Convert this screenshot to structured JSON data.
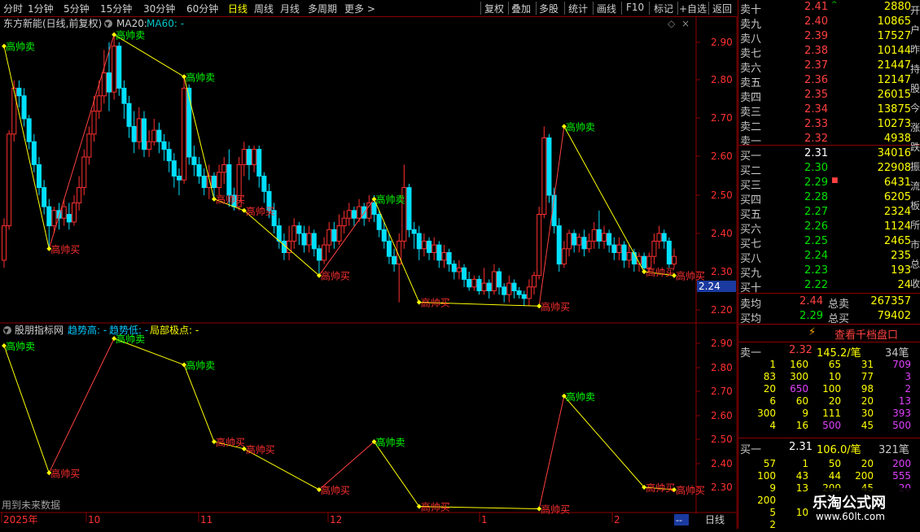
{
  "toolbar": {
    "periods": [
      "分时",
      "1分钟",
      "5分钟",
      "15分钟",
      "30分钟",
      "60分钟",
      "日线",
      "周线",
      "月线",
      "多周期",
      "更多 >"
    ],
    "active": "日线",
    "tools": [
      "复权",
      "叠加",
      "多股",
      "统计",
      "画线",
      "F10",
      "标记",
      "+自选",
      "返回"
    ]
  },
  "main_chart": {
    "title": "东方新能(日线,前复权)",
    "ma20_label": "MA20:",
    "ma60_label": "MA60: -",
    "price_ticks": [
      "2.90",
      "2.80",
      "2.70",
      "2.60",
      "2.50",
      "2.40",
      "2.30",
      "2.20"
    ],
    "current_price_tag": "2.24",
    "label_sell": "高帅卖",
    "label_buy": "高帅买"
  },
  "indicator": {
    "title": "股朋指标网",
    "trend_high": "趋势高: -",
    "trend_low": "趋势低: -",
    "local_extreme": "局部极点: -",
    "ticks": [
      "2.90",
      "2.80",
      "2.70",
      "2.60",
      "2.50",
      "2.40",
      "2.30"
    ],
    "note": "用到未来数据"
  },
  "time_axis": {
    "labels": [
      "2025年",
      "10",
      "11",
      "12",
      "1",
      "2"
    ],
    "end_marker": "--",
    "period_label": "日线"
  },
  "chart_data": {
    "type": "line",
    "title": "",
    "ylim": [
      2.17,
      2.93
    ],
    "pivots": [
      {
        "x": 0,
        "price": 2.89,
        "kind": "sell"
      },
      {
        "x": 9,
        "price": 2.36,
        "kind": "buy"
      },
      {
        "x": 22,
        "price": 2.92,
        "kind": "sell"
      },
      {
        "x": 36,
        "price": 2.81,
        "kind": "sell"
      },
      {
        "x": 42,
        "price": 2.49,
        "kind": "buy"
      },
      {
        "x": 48,
        "price": 2.46,
        "kind": "buy"
      },
      {
        "x": 63,
        "price": 2.29,
        "kind": "buy"
      },
      {
        "x": 74,
        "price": 2.49,
        "kind": "sell"
      },
      {
        "x": 83,
        "price": 2.22,
        "kind": "buy"
      },
      {
        "x": 107,
        "price": 2.21,
        "kind": "buy"
      },
      {
        "x": 112,
        "price": 2.68,
        "kind": "sell"
      },
      {
        "x": 128,
        "price": 2.3,
        "kind": "buy"
      },
      {
        "x": 134,
        "price": 2.29,
        "kind": "buy"
      }
    ],
    "candles": [
      [
        2.33,
        2.42,
        2.31,
        2.44
      ],
      [
        2.42,
        2.66,
        2.41,
        2.67
      ],
      [
        2.66,
        2.78,
        2.64,
        2.8
      ],
      [
        2.78,
        2.76,
        2.73,
        2.8
      ],
      [
        2.76,
        2.7,
        2.68,
        2.78
      ],
      [
        2.7,
        2.64,
        2.62,
        2.71
      ],
      [
        2.64,
        2.58,
        2.56,
        2.66
      ],
      [
        2.58,
        2.52,
        2.5,
        2.6
      ],
      [
        2.52,
        2.47,
        2.45,
        2.54
      ],
      [
        2.47,
        2.42,
        2.36,
        2.49
      ],
      [
        2.42,
        2.46,
        2.4,
        2.47
      ],
      [
        2.46,
        2.44,
        2.41,
        2.48
      ],
      [
        2.44,
        2.47,
        2.42,
        2.49
      ],
      [
        2.45,
        2.43,
        2.41,
        2.48
      ],
      [
        2.43,
        2.48,
        2.42,
        2.5
      ],
      [
        2.48,
        2.52,
        2.46,
        2.55
      ],
      [
        2.52,
        2.6,
        2.5,
        2.62
      ],
      [
        2.6,
        2.66,
        2.58,
        2.68
      ],
      [
        2.66,
        2.72,
        2.64,
        2.76
      ],
      [
        2.72,
        2.76,
        2.7,
        2.8
      ],
      [
        2.76,
        2.82,
        2.74,
        2.88
      ],
      [
        2.82,
        2.77,
        2.72,
        2.9
      ],
      [
        2.77,
        2.89,
        2.75,
        2.92
      ],
      [
        2.89,
        2.78,
        2.76,
        2.9
      ],
      [
        2.78,
        2.74,
        2.7,
        2.8
      ],
      [
        2.74,
        2.68,
        2.65,
        2.76
      ],
      [
        2.68,
        2.64,
        2.61,
        2.72
      ],
      [
        2.64,
        2.7,
        2.62,
        2.73
      ],
      [
        2.7,
        2.62,
        2.6,
        2.72
      ],
      [
        2.62,
        2.64,
        2.6,
        2.67
      ],
      [
        2.64,
        2.67,
        2.63,
        2.7
      ],
      [
        2.67,
        2.64,
        2.61,
        2.69
      ],
      [
        2.64,
        2.62,
        2.59,
        2.66
      ],
      [
        2.62,
        2.59,
        2.56,
        2.64
      ],
      [
        2.59,
        2.55,
        2.52,
        2.61
      ],
      [
        2.55,
        2.54,
        2.5,
        2.57
      ],
      [
        2.54,
        2.78,
        2.53,
        2.81
      ],
      [
        2.78,
        2.6,
        2.58,
        2.79
      ],
      [
        2.6,
        2.58,
        2.55,
        2.63
      ],
      [
        2.58,
        2.55,
        2.53,
        2.6
      ],
      [
        2.55,
        2.52,
        2.5,
        2.57
      ],
      [
        2.52,
        2.55,
        2.49,
        2.58
      ],
      [
        2.55,
        2.52,
        2.49,
        2.56
      ],
      [
        2.52,
        2.56,
        2.5,
        2.58
      ],
      [
        2.56,
        2.58,
        2.53,
        2.6
      ],
      [
        2.58,
        2.5,
        2.47,
        2.62
      ],
      [
        2.5,
        2.47,
        2.46,
        2.52
      ],
      [
        2.47,
        2.58,
        2.46,
        2.6
      ],
      [
        2.58,
        2.62,
        2.55,
        2.64
      ],
      [
        2.62,
        2.58,
        2.54,
        2.63
      ],
      [
        2.58,
        2.62,
        2.56,
        2.63
      ],
      [
        2.62,
        2.55,
        2.52,
        2.63
      ],
      [
        2.55,
        2.51,
        2.48,
        2.56
      ],
      [
        2.51,
        2.46,
        2.44,
        2.53
      ],
      [
        2.46,
        2.42,
        2.4,
        2.48
      ],
      [
        2.42,
        2.38,
        2.36,
        2.44
      ],
      [
        2.38,
        2.35,
        2.33,
        2.4
      ],
      [
        2.35,
        2.38,
        2.33,
        2.42
      ],
      [
        2.38,
        2.42,
        2.36,
        2.44
      ],
      [
        2.42,
        2.4,
        2.37,
        2.43
      ],
      [
        2.4,
        2.37,
        2.35,
        2.42
      ],
      [
        2.37,
        2.4,
        2.35,
        2.42
      ],
      [
        2.4,
        2.36,
        2.34,
        2.41
      ],
      [
        2.36,
        2.33,
        2.29,
        2.37
      ],
      [
        2.33,
        2.37,
        2.32,
        2.39
      ],
      [
        2.37,
        2.41,
        2.35,
        2.43
      ],
      [
        2.41,
        2.38,
        2.36,
        2.43
      ],
      [
        2.38,
        2.42,
        2.37,
        2.45
      ],
      [
        2.42,
        2.44,
        2.4,
        2.46
      ],
      [
        2.44,
        2.46,
        2.42,
        2.48
      ],
      [
        2.46,
        2.44,
        2.42,
        2.47
      ],
      [
        2.44,
        2.47,
        2.43,
        2.49
      ],
      [
        2.47,
        2.44,
        2.42,
        2.48
      ],
      [
        2.44,
        2.48,
        2.43,
        2.5
      ],
      [
        2.48,
        2.45,
        2.43,
        2.5
      ],
      [
        2.45,
        2.41,
        2.39,
        2.46
      ],
      [
        2.41,
        2.38,
        2.36,
        2.43
      ],
      [
        2.38,
        2.34,
        2.32,
        2.4
      ],
      [
        2.34,
        2.32,
        2.3,
        2.36
      ],
      [
        2.32,
        2.38,
        2.22,
        2.4
      ],
      [
        2.38,
        2.52,
        2.36,
        2.58
      ],
      [
        2.52,
        2.41,
        2.39,
        2.53
      ],
      [
        2.41,
        2.4,
        2.36,
        2.43
      ],
      [
        2.4,
        2.36,
        2.33,
        2.42
      ],
      [
        2.36,
        2.38,
        2.34,
        2.4
      ],
      [
        2.38,
        2.35,
        2.33,
        2.39
      ],
      [
        2.35,
        2.37,
        2.33,
        2.39
      ],
      [
        2.37,
        2.33,
        2.31,
        2.38
      ],
      [
        2.33,
        2.35,
        2.31,
        2.37
      ],
      [
        2.35,
        2.32,
        2.3,
        2.36
      ],
      [
        2.32,
        2.3,
        2.28,
        2.33
      ],
      [
        2.3,
        2.31,
        2.28,
        2.33
      ],
      [
        2.31,
        2.28,
        2.26,
        2.32
      ],
      [
        2.28,
        2.26,
        2.25,
        2.3
      ],
      [
        2.26,
        2.28,
        2.25,
        2.29
      ],
      [
        2.28,
        2.25,
        2.24,
        2.29
      ],
      [
        2.25,
        2.27,
        2.24,
        2.31
      ],
      [
        2.27,
        2.25,
        2.23,
        2.28
      ],
      [
        2.25,
        2.3,
        2.24,
        2.32
      ],
      [
        2.3,
        2.26,
        2.24,
        2.31
      ],
      [
        2.26,
        2.24,
        2.22,
        2.27
      ],
      [
        2.24,
        2.27,
        2.22,
        2.29
      ],
      [
        2.27,
        2.25,
        2.23,
        2.28
      ],
      [
        2.25,
        2.24,
        2.23,
        2.26
      ],
      [
        2.24,
        2.23,
        2.21,
        2.25
      ],
      [
        2.23,
        2.26,
        2.21,
        2.28
      ],
      [
        2.26,
        2.29,
        2.24,
        2.3
      ],
      [
        2.29,
        2.45,
        2.28,
        2.47
      ],
      [
        2.45,
        2.65,
        2.44,
        2.68
      ],
      [
        2.65,
        2.5,
        2.48,
        2.66
      ],
      [
        2.5,
        2.42,
        2.4,
        2.52
      ],
      [
        2.42,
        2.32,
        2.3,
        2.44
      ],
      [
        2.32,
        2.36,
        2.31,
        2.38
      ],
      [
        2.36,
        2.4,
        2.34,
        2.41
      ],
      [
        2.4,
        2.37,
        2.35,
        2.41
      ],
      [
        2.37,
        2.39,
        2.35,
        2.4
      ],
      [
        2.39,
        2.36,
        2.34,
        2.41
      ],
      [
        2.36,
        2.38,
        2.35,
        2.4
      ],
      [
        2.38,
        2.41,
        2.36,
        2.43
      ],
      [
        2.41,
        2.38,
        2.36,
        2.46
      ],
      [
        2.38,
        2.4,
        2.36,
        2.42
      ],
      [
        2.4,
        2.37,
        2.35,
        2.41
      ],
      [
        2.37,
        2.35,
        2.33,
        2.39
      ],
      [
        2.35,
        2.37,
        2.33,
        2.39
      ],
      [
        2.37,
        2.33,
        2.31,
        2.38
      ],
      [
        2.33,
        2.35,
        2.31,
        2.37
      ],
      [
        2.35,
        2.32,
        2.3,
        2.36
      ],
      [
        2.32,
        2.34,
        2.3,
        2.35
      ],
      [
        2.34,
        2.31,
        2.3,
        2.35
      ],
      [
        2.31,
        2.34,
        2.3,
        2.35
      ],
      [
        2.34,
        2.38,
        2.32,
        2.4
      ],
      [
        2.38,
        2.4,
        2.36,
        2.42
      ],
      [
        2.4,
        2.38,
        2.36,
        2.41
      ],
      [
        2.38,
        2.32,
        2.31,
        2.39
      ],
      [
        2.32,
        2.34,
        2.31,
        2.36
      ]
    ]
  },
  "orderbook": {
    "asks": [
      {
        "label": "卖十",
        "price": "2.41",
        "vol": "2880",
        "mark": "^"
      },
      {
        "label": "卖九",
        "price": "2.40",
        "vol": "10865",
        "mark": ""
      },
      {
        "label": "卖八",
        "price": "2.39",
        "vol": "17527",
        "mark": ""
      },
      {
        "label": "卖七",
        "price": "2.38",
        "vol": "10144",
        "mark": ""
      },
      {
        "label": "卖六",
        "price": "2.37",
        "vol": "21447",
        "mark": ""
      },
      {
        "label": "卖五",
        "price": "2.36",
        "vol": "12147",
        "mark": ""
      },
      {
        "label": "卖四",
        "price": "2.35",
        "vol": "26015",
        "mark": ""
      },
      {
        "label": "卖三",
        "price": "2.34",
        "vol": "13875",
        "mark": ""
      },
      {
        "label": "卖二",
        "price": "2.33",
        "vol": "10273",
        "mark": ""
      },
      {
        "label": "卖一",
        "price": "2.32",
        "vol": "4938",
        "mark": ""
      }
    ],
    "bids": [
      {
        "label": "买一",
        "price": "2.31",
        "vol": "34016",
        "color": "white",
        "mark": ""
      },
      {
        "label": "买二",
        "price": "2.30",
        "vol": "22908",
        "color": "green",
        "mark": ""
      },
      {
        "label": "买三",
        "price": "2.29",
        "vol": "6431",
        "color": "green",
        "mark": "■"
      },
      {
        "label": "买四",
        "price": "2.28",
        "vol": "6205",
        "color": "green",
        "mark": ""
      },
      {
        "label": "买五",
        "price": "2.27",
        "vol": "2324",
        "color": "green",
        "mark": ""
      },
      {
        "label": "买六",
        "price": "2.26",
        "vol": "1124",
        "color": "green",
        "mark": ""
      },
      {
        "label": "买七",
        "price": "2.25",
        "vol": "2465",
        "color": "green",
        "mark": ""
      },
      {
        "label": "买八",
        "price": "2.24",
        "vol": "235",
        "color": "green",
        "mark": ""
      },
      {
        "label": "买九",
        "price": "2.23",
        "vol": "193",
        "color": "green",
        "mark": ""
      },
      {
        "label": "买十",
        "price": "2.22",
        "vol": "24",
        "color": "green",
        "mark": ""
      }
    ],
    "avg_sell": {
      "label": "卖均",
      "price": "2.44",
      "tlabel": "总卖",
      "vol": "267357"
    },
    "avg_buy": {
      "label": "买均",
      "price": "2.29",
      "tlabel": "总买",
      "vol": "79402"
    },
    "tenlevel_button": "查看千档盘口",
    "ask1_queue": {
      "label": "卖一",
      "price": "2.32",
      "avg": "145.2/笔",
      "count": "34笔"
    },
    "ask_queue_rows": [
      [
        "1",
        "160",
        "65",
        "31",
        "709"
      ],
      [
        "83",
        "300",
        "10",
        "77",
        "3"
      ],
      [
        "20",
        "650",
        "100",
        "98",
        "2"
      ],
      [
        "6",
        "60",
        "20",
        "20",
        "13"
      ],
      [
        "300",
        "9",
        "111",
        "30",
        "393"
      ],
      [
        "4",
        "16",
        "500",
        "45",
        "500"
      ]
    ],
    "bid1_queue": {
      "label": "买一",
      "price": "2.31",
      "avg": "106.0/笔",
      "count": "321笔"
    },
    "bid_queue_rows": [
      [
        "57",
        "1",
        "50",
        "20",
        "200"
      ],
      [
        "100",
        "43",
        "44",
        "200",
        "555"
      ],
      [
        "9",
        "13",
        "200",
        "45",
        "20"
      ],
      [
        "200",
        "",
        "",
        "",
        ""
      ],
      [
        "5",
        "10",
        "",
        "",
        ""
      ],
      [
        "2",
        "",
        "",
        "",
        ""
      ]
    ],
    "side_text": [
      "开",
      "户",
      "昨",
      "持",
      "股",
      "今",
      "涨",
      "跌",
      "振",
      "流",
      "板",
      "所",
      "市",
      "总",
      "收"
    ],
    "watermark_title": "乐淘公式网",
    "watermark_url": "www.60lt.com"
  },
  "colors": {
    "up": "#ff3030",
    "down": "#00e0ff",
    "zigzag": "#ffff00",
    "sell_label": "#00ff00",
    "buy_label": "#ff3030",
    "grid_border": "#8b0000"
  }
}
